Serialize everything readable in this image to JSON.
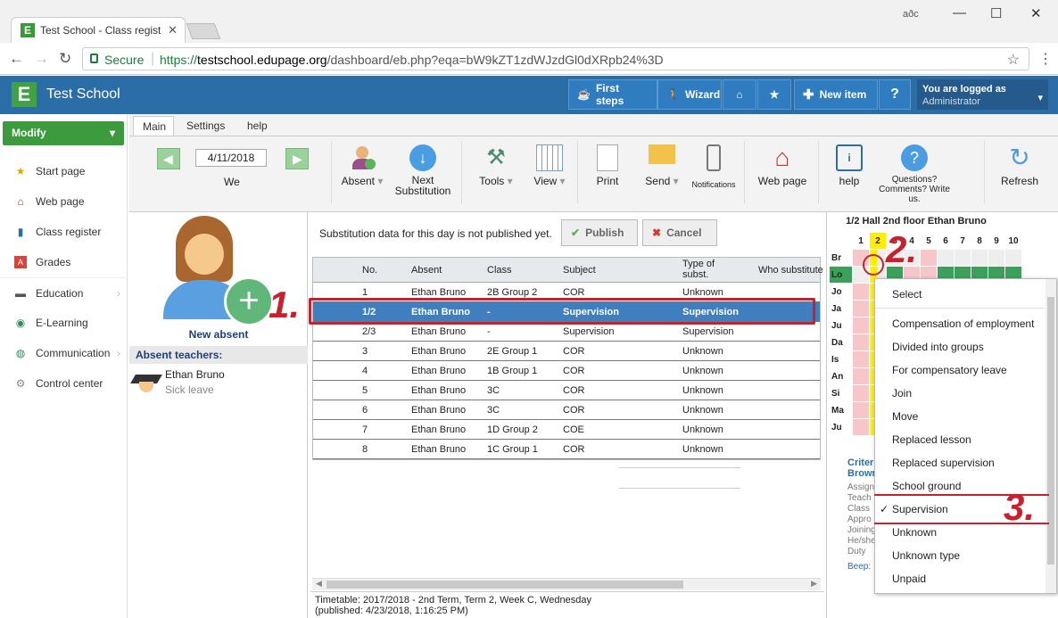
{
  "browser": {
    "tab_title": "Test School - Class regist",
    "secure_label": "Secure",
    "url_prefix": "https://",
    "url_host": "testschool.edupage.org",
    "url_path": "/dashboard/eb.php?eqa=bW9kZT1zdWJzdGl0dXRpb24%3D",
    "profile_badge": "aðc"
  },
  "header": {
    "brand": "Test School",
    "first_steps": "First steps",
    "wizard": "Wizard",
    "new_item": "New item",
    "help": "?",
    "logged_as": "You are logged as",
    "user": "Administrator"
  },
  "sidebar": {
    "modify": "Modify",
    "items": [
      {
        "label": "Start page"
      },
      {
        "label": "Web page"
      },
      {
        "label": "Class register"
      },
      {
        "label": "Grades"
      },
      {
        "label": "Education"
      },
      {
        "label": "E-Learning"
      },
      {
        "label": "Communication"
      },
      {
        "label": "Control center"
      }
    ]
  },
  "ribbon": {
    "tabs": [
      "Main",
      "Settings",
      "help"
    ],
    "date": "4/11/2018",
    "day": "We",
    "absent": "Absent",
    "next_sub_1": "Next",
    "next_sub_2": "Substitution",
    "tools": "Tools",
    "view": "View",
    "print": "Print",
    "send": "Send",
    "notifications": "Notifications",
    "web_page": "Web page",
    "help": "help",
    "questions_1": "Questions?",
    "questions_2": "Comments? Write",
    "questions_3": "us.",
    "refresh": "Refresh"
  },
  "left_panel": {
    "new_absent": "New absent",
    "absent_teachers": "Absent teachers:",
    "teacher": "Ethan Bruno",
    "reason": "Sick leave"
  },
  "center": {
    "notice": "Substitution data for this day is not published yet.",
    "publish": "Publish",
    "cancel": "Cancel",
    "columns": [
      "No.",
      "Absent",
      "Class",
      "Subject",
      "Type of subst.",
      "Who substitute"
    ],
    "rows": [
      {
        "no": "1",
        "absent": "Ethan Bruno",
        "cls": "2B Group 2",
        "subj": "COR",
        "type": "Unknown"
      },
      {
        "no": "1/2",
        "absent": "Ethan Bruno",
        "cls": "-",
        "subj": "Supervision",
        "type": "Supervision"
      },
      {
        "no": "2/3",
        "absent": "Ethan Bruno",
        "cls": "-",
        "subj": "Supervision",
        "type": "Supervision"
      },
      {
        "no": "3",
        "absent": "Ethan Bruno",
        "cls": "2E Group 1",
        "subj": "COR",
        "type": "Unknown"
      },
      {
        "no": "4",
        "absent": "Ethan Bruno",
        "cls": "1B Group 1",
        "subj": "COR",
        "type": "Unknown"
      },
      {
        "no": "5",
        "absent": "Ethan Bruno",
        "cls": "3C",
        "subj": "COR",
        "type": "Unknown"
      },
      {
        "no": "6",
        "absent": "Ethan Bruno",
        "cls": "3C",
        "subj": "COR",
        "type": "Unknown"
      },
      {
        "no": "7",
        "absent": "Ethan Bruno",
        "cls": "1D Group 2",
        "subj": "COE",
        "type": "Unknown"
      },
      {
        "no": "8",
        "absent": "Ethan Bruno",
        "cls": "1C Group 1",
        "subj": "COR",
        "type": "Unknown"
      }
    ],
    "footer_1": "Timetable: 2017/2018 - 2nd Term, Term 2, Week C, Wednesday",
    "footer_2": "(published: 4/23/2018, 1:16:25 PM)"
  },
  "right_panel": {
    "title": "1/2 Hall 2nd floor Ethan Bruno",
    "periods": [
      "1",
      "2",
      "3",
      "4",
      "5",
      "6",
      "7",
      "8",
      "9",
      "10"
    ],
    "teachers": [
      "Br",
      "Lo",
      "Jo",
      "Ja",
      "Ju",
      "Da",
      "Is",
      "An",
      "Si",
      "Ma",
      "Ju"
    ],
    "criteria_1": "Criteri",
    "criteria_2": "Brown",
    "details": [
      "Assign",
      "Teach",
      "Class",
      "Appro",
      "Joining",
      "He/she",
      "Duty"
    ],
    "beep": "Beep:"
  },
  "menu": {
    "items": [
      "Select",
      "Compensation of employment",
      "Divided into groups",
      "For compensatory leave",
      "Join",
      "Move",
      "Replaced lesson",
      "Replaced supervision",
      "School ground",
      "Supervision",
      "Unknown",
      "Unknown type",
      "Unpaid"
    ],
    "checked": "Supervision",
    "check": "✓"
  },
  "annotations": [
    "1.",
    "2.",
    "3."
  ],
  "colors": {
    "header": "#2b6ea7",
    "selected_row": "#3f7fc0",
    "annotation": "#c8202e",
    "green": "#3c9b3c"
  }
}
